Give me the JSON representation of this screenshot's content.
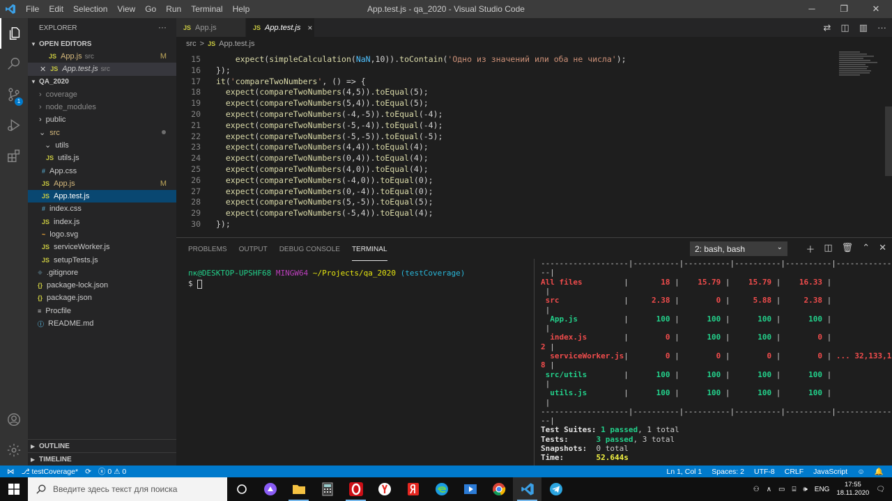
{
  "window": {
    "title": "App.test.js - qa_2020 - Visual Studio Code",
    "menu": [
      "File",
      "Edit",
      "Selection",
      "View",
      "Go",
      "Run",
      "Terminal",
      "Help"
    ]
  },
  "activity": {
    "scm_badge": "1"
  },
  "explorer": {
    "title": "EXPLORER",
    "open_editors_title": "OPEN EDITORS",
    "open_editors": [
      {
        "icon": "JS",
        "name": "App.js",
        "desc": "src",
        "mark": "M"
      },
      {
        "icon": "JS",
        "name": "App.test.js",
        "desc": "src",
        "mark": ""
      }
    ],
    "project_title": "QA_2020",
    "tree": [
      {
        "kind": "folder",
        "name": "coverage"
      },
      {
        "kind": "folder",
        "name": "node_modules"
      },
      {
        "kind": "folder",
        "name": "public"
      },
      {
        "kind": "folder",
        "name": "src"
      },
      {
        "kind": "folder",
        "name": "utils"
      },
      {
        "icon": "JS",
        "name": "utils.js"
      },
      {
        "icon": "#",
        "name": "App.css"
      },
      {
        "icon": "JS",
        "name": "App.js",
        "mark": "M"
      },
      {
        "icon": "JS",
        "name": "App.test.js"
      },
      {
        "icon": "#",
        "name": "index.css"
      },
      {
        "icon": "JS",
        "name": "index.js"
      },
      {
        "icon": "~",
        "name": "logo.svg"
      },
      {
        "icon": "JS",
        "name": "serviceWorker.js"
      },
      {
        "icon": "JS",
        "name": "setupTests.js"
      },
      {
        "icon": "◆",
        "name": ".gitignore"
      },
      {
        "icon": "{}",
        "name": "package-lock.json"
      },
      {
        "icon": "{}",
        "name": "package.json"
      },
      {
        "icon": "≡",
        "name": "Procfile"
      },
      {
        "icon": "ⓘ",
        "name": "README.md"
      }
    ],
    "outline_title": "OUTLINE",
    "timeline_title": "TIMELINE"
  },
  "tabs": [
    {
      "icon": "JS",
      "name": "App.js"
    },
    {
      "icon": "JS",
      "name": "App.test.js",
      "close": "×"
    }
  ],
  "breadcrumb": {
    "folder": "src",
    "sep": ">",
    "icon": "JS",
    "file": "App.test.js"
  },
  "editor": {
    "lines": [
      {
        "n": "15",
        "code": "    expect(simpleCalculation(NaN,10)).toContain('Одно из значений или оба не числа');"
      },
      {
        "n": "16",
        "code": "});"
      },
      {
        "n": "17",
        "code": "it('compareTwoNumbers', () => {"
      },
      {
        "n": "18",
        "code": "  expect(compareTwoNumbers(4,5)).toEqual(5);"
      },
      {
        "n": "19",
        "code": "  expect(compareTwoNumbers(5,4)).toEqual(5);"
      },
      {
        "n": "20",
        "code": "  expect(compareTwoNumbers(-4,-5)).toEqual(-4);"
      },
      {
        "n": "21",
        "code": "  expect(compareTwoNumbers(-5,-4)).toEqual(-4);"
      },
      {
        "n": "22",
        "code": "  expect(compareTwoNumbers(-5,-5)).toEqual(-5);"
      },
      {
        "n": "23",
        "code": "  expect(compareTwoNumbers(4,4)).toEqual(4);"
      },
      {
        "n": "24",
        "code": "  expect(compareTwoNumbers(0,4)).toEqual(4);"
      },
      {
        "n": "25",
        "code": "  expect(compareTwoNumbers(4,0)).toEqual(4);"
      },
      {
        "n": "26",
        "code": "  expect(compareTwoNumbers(-4,0)).toEqual(0);"
      },
      {
        "n": "27",
        "code": "  expect(compareTwoNumbers(0,-4)).toEqual(0);"
      },
      {
        "n": "28",
        "code": "  expect(compareTwoNumbers(5,-5)).toEqual(5);"
      },
      {
        "n": "29",
        "code": "  expect(compareTwoNumbers(-5,4)).toEqual(4);"
      },
      {
        "n": "30",
        "code": "});"
      }
    ]
  },
  "panel": {
    "tabs": [
      "PROBLEMS",
      "OUTPUT",
      "DEBUG CONSOLE",
      "TERMINAL"
    ],
    "terminal_select": "2: bash, bash",
    "prompt": {
      "user": "пк@DESKTOP-UPSHF68",
      "env": "MINGW64",
      "path": "~/Projects/qa_2020",
      "branch": "(testCoverage)",
      "symbol": "$"
    },
    "coverage": {
      "divider": "-------------------|----------|----------|----------|----------|-------------------",
      "wrap_dash": "--|",
      "wrap_bar": " |",
      "rows": [
        {
          "name": "All files",
          "v": [
            "18",
            "15.79",
            "15.79",
            "16.33"
          ],
          "uncovered": "",
          "wrap": ""
        },
        {
          "name": " src",
          "v": [
            "2.38",
            "0",
            "5.88",
            "2.38"
          ],
          "uncovered": "",
          "wrap": ""
        },
        {
          "name": "  App.js",
          "v": [
            "100",
            "100",
            "100",
            "100"
          ],
          "uncovered": "",
          "wrap": ""
        },
        {
          "name": "  index.js",
          "v": [
            "0",
            "100",
            "100",
            "0"
          ],
          "uncovered": "7,1",
          "wrap": "2 |"
        },
        {
          "name": "  serviceWorker.js",
          "v": [
            "0",
            "0",
            "0",
            "0"
          ],
          "uncovered": "... 32,133,135,13",
          "wrap": "8 |"
        },
        {
          "name": " src/utils",
          "v": [
            "100",
            "100",
            "100",
            "100"
          ],
          "uncovered": "",
          "wrap": ""
        },
        {
          "name": "  utils.js",
          "v": [
            "100",
            "100",
            "100",
            "100"
          ],
          "uncovered": "",
          "wrap": ""
        }
      ],
      "summary": {
        "suites_label": "Test Suites:",
        "suites_passed": "1 passed",
        "suites_total": ", 1 total",
        "tests_label": "Tests:",
        "tests_passed": "3 passed",
        "tests_total": ", 3 total",
        "snap_label": "Snapshots:",
        "snap_total": "0 total",
        "time_label": "Time:",
        "time_value": "52.644s"
      }
    }
  },
  "status": {
    "branch": "testCoverage*",
    "errors": "0",
    "warnings": "0",
    "position": "Ln 1, Col 1",
    "spaces": "Spaces: 2",
    "encoding": "UTF-8",
    "eol": "CRLF",
    "language": "JavaScript"
  },
  "taskbar": {
    "search_placeholder": "Введите здесь текст для поиска",
    "lang": "ENG",
    "time": "17:55",
    "date": "18.11.2020"
  },
  "colors": {
    "accent": "#007acc",
    "activity": "#333333",
    "sidebar": "#252526",
    "editor": "#1e1e1e"
  }
}
